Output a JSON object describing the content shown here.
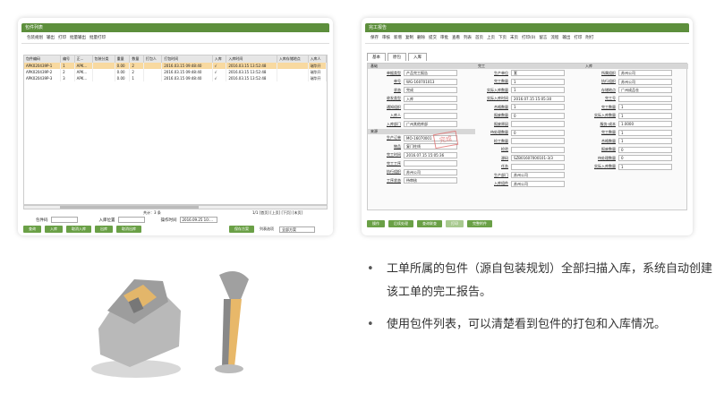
{
  "left_window": {
    "title": "包件列表",
    "menu": [
      "包装规划",
      "输出",
      "打印",
      "批量输出",
      "批量打印"
    ],
    "columns": [
      "包件编码",
      "编号",
      "正...",
      "包装分类",
      "重量",
      "数量",
      "打包人",
      "打包时间",
      "入库",
      "入库时间",
      "入库存储地点",
      "入库人"
    ],
    "rows": [
      [
        "APK020439P-1",
        "1",
        "APK...",
        "",
        "0.00",
        "2",
        "",
        "2016.03.15 09:48:40",
        "√",
        "2016.03.15 13:52:48",
        "",
        "瑞华开"
      ],
      [
        "APK020439P-2",
        "2",
        "APK...",
        "",
        "0.00",
        "2",
        "",
        "2016.03.15 09:48:40",
        "√",
        "2016.03.15 13:52:48",
        "",
        "瑞华开"
      ],
      [
        "APK020439P-3",
        "3",
        "APK...",
        "",
        "0.00",
        "1",
        "",
        "2016.03.15 09:48:40",
        "√",
        "2016.03.15 13:52:48",
        "",
        "瑞华开"
      ]
    ],
    "total_text": "共计：3 条",
    "pager_text": "1/1 [首页] [上页] [下页] [末页]",
    "filter": {
      "package_label": "包件码",
      "location_label": "入库位置",
      "time_label": "操作时间",
      "time_value": "2016.09.25 10:..."
    },
    "buttons": [
      "查询",
      "入库",
      "取消入库",
      "出库",
      "取消出库"
    ],
    "right_buttons": [
      "保存方案",
      "列表选项"
    ],
    "scheme_select": "全部方案"
  },
  "right_window": {
    "title": "完工报告",
    "menu": [
      "保存",
      "审核",
      "新增",
      "复制",
      "删除",
      "提交",
      "审批",
      "查看",
      "列表",
      "首页",
      "上页",
      "下页",
      "末页",
      "打印(0)",
      "留言",
      "流程",
      "输出",
      "打印",
      "附打"
    ],
    "tabs": [
      "基本",
      "原包",
      "入库"
    ],
    "sec_basic": "基础",
    "sec_source": "来源",
    "sec_finish": "完工",
    "sec_receive": "入库",
    "sec_outsource": "成本单位",
    "col1": [
      {
        "label": "单据类型",
        "value": "产品完工报告"
      },
      {
        "label": "单号",
        "value": "WG-160701013"
      },
      {
        "label": "状态",
        "value": "完成"
      },
      {
        "label": "收发类型",
        "value": "入库"
      },
      {
        "label": "通知组织",
        "value": ""
      },
      {
        "label": "入库人",
        "value": ""
      },
      {
        "label": "入库部门",
        "value": "广州其他库部"
      }
    ],
    "col1b": [
      {
        "label": "生产订单",
        "value": "MO-16070001"
      },
      {
        "label": "物品",
        "value": "复门柱线"
      },
      {
        "label": "完工时间",
        "value": "2016.07.15 15:05:36"
      },
      {
        "label": "完工工序",
        "value": ""
      },
      {
        "label": "执行组织",
        "value": "苏州公司"
      },
      {
        "label": "工序状态",
        "value": "待审核"
      }
    ],
    "col2": [
      {
        "label": "生产单位",
        "value": "套"
      },
      {
        "label": "完工数量",
        "value": "1"
      },
      {
        "label": "实际入库数量",
        "value": "1"
      },
      {
        "label": "实际入库时间",
        "value": "2016.07.15 15:05:30"
      },
      {
        "label": "合格数量",
        "value": "1"
      },
      {
        "label": "报废数量",
        "value": "0"
      },
      {
        "label": "报废原因",
        "value": ""
      },
      {
        "label": "待处理数量",
        "value": "0"
      },
      {
        "label": "检工数量",
        "value": ""
      },
      {
        "label": "检验",
        "value": ""
      },
      {
        "label": "源码",
        "value": "SZB01607000101-3/3"
      },
      {
        "label": "任务",
        "value": ""
      },
      {
        "label": "生产部门",
        "value": "苏州公司"
      },
      {
        "label": "入库组件",
        "value": "苏州公司"
      }
    ],
    "col3": [
      {
        "label": "所属组织",
        "value": "苏州公司"
      },
      {
        "label": "执行组织",
        "value": "苏州公司"
      },
      {
        "label": "存储地点",
        "value": "广州成品仓"
      },
      {
        "label": "完工号",
        "value": ""
      },
      {
        "label": "完工数量",
        "value": "1"
      },
      {
        "label": "实际入库数量",
        "value": "1"
      },
      {
        "label": "服务-成本",
        "value": "1.0000"
      },
      {
        "label": "完工数量",
        "value": "1"
      },
      {
        "label": "合格数量",
        "value": "1"
      },
      {
        "label": "报废数量",
        "value": "0"
      },
      {
        "label": "待处理数量",
        "value": "0"
      },
      {
        "label": "实际入库数量",
        "value": "1"
      }
    ],
    "stamp": "完成",
    "bottom_buttons": [
      "操作",
      "后续处理",
      "查询联查",
      "打印",
      "完整附件"
    ]
  },
  "bullets": [
    "工单所属的包件（源自包装规划）全部扫描入库，系统自动创建该工单的完工报告。",
    "使用包件列表，可以清楚看到包件的打包和入库情况。"
  ]
}
